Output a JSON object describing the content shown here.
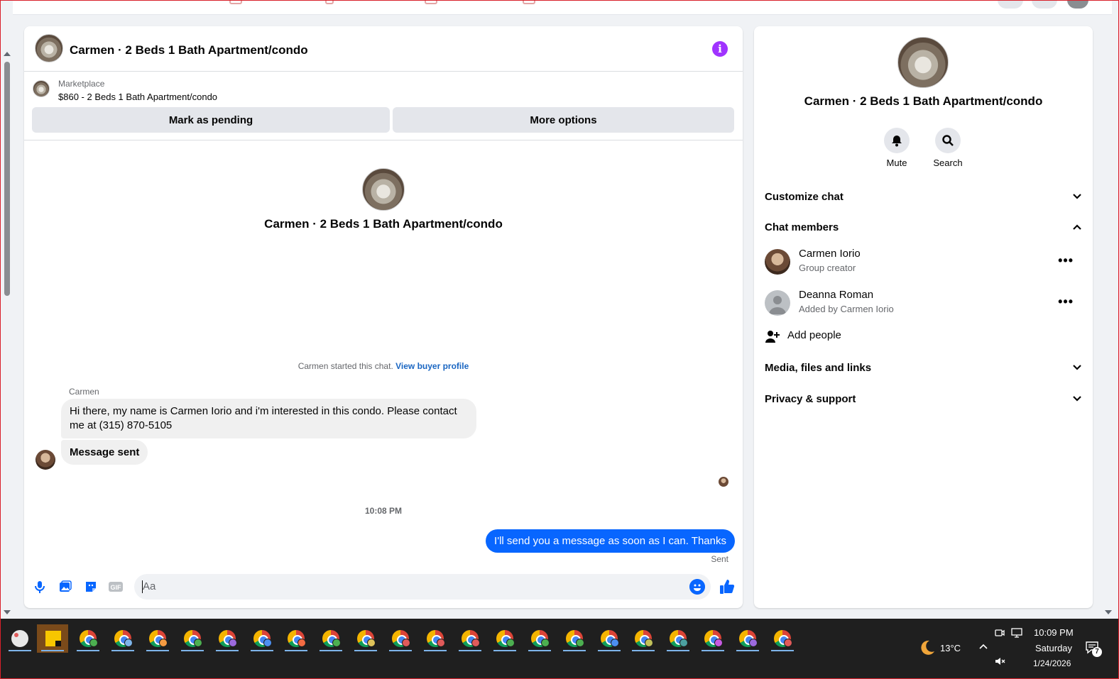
{
  "chat": {
    "title": "Carmen · 2 Beds 1 Bath Apartment/condo",
    "marketplace_label": "Marketplace",
    "listing": "$860 - 2 Beds 1 Bath Apartment/condo",
    "mark_pending_label": "Mark as pending",
    "more_options_label": "More options",
    "intro_title": "Carmen · 2 Beds 1 Bath Apartment/condo",
    "started_text": "Carmen started this chat.",
    "view_buyer_profile": "View buyer profile",
    "sender_name": "Carmen",
    "messages": [
      {
        "text": "Hi there, my name is Carmen Iorio and i'm interested in this condo. Please contact me at (315) 870-5105"
      },
      {
        "text": "Message sent"
      }
    ],
    "timestamp": "10:08 PM",
    "outgoing": "I'll send you a message as soon as I can. Thanks",
    "sent_status": "Sent",
    "composer_placeholder": "Aa"
  },
  "side": {
    "title": "Carmen · 2 Beds 1 Bath Apartment/condo",
    "mute_label": "Mute",
    "search_label": "Search",
    "sections": {
      "customize": "Customize chat",
      "members": "Chat members",
      "media": "Media, files and links",
      "privacy": "Privacy & support"
    },
    "members": [
      {
        "name": "Carmen Iorio",
        "sub": "Group creator"
      },
      {
        "name": "Deanna Roman",
        "sub": "Added by Carmen Iorio"
      }
    ],
    "add_people": "Add people"
  },
  "taskbar": {
    "weather": "13°C",
    "time": "10:09 PM",
    "day": "Saturday",
    "date": "1/24/2026",
    "notifications": "7",
    "badge_colors": [
      "#4caf50",
      "#7eb4ea",
      "#f59b42",
      "#4caf50",
      "#9c6ade",
      "#4c8ff0",
      "#f56b42",
      "#4caf50",
      "#e0c35a",
      "#e05a5a",
      "#e05a5a",
      "#e05a5a",
      "#4caf50",
      "#4caf50",
      "#4caf50",
      "#4c8ff0",
      "#c0c05a",
      "#4ca0a0",
      "#c65ae0",
      "#9c6ade",
      "#e05a5a"
    ]
  },
  "colors": {
    "accent": "#0866ff",
    "info": "#a033ff"
  }
}
